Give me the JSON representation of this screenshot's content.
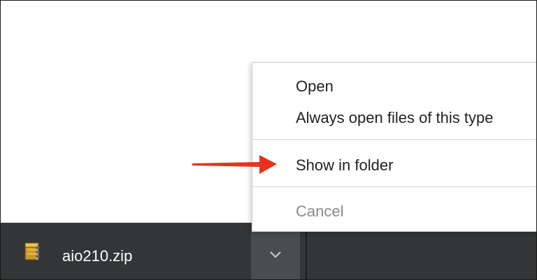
{
  "download": {
    "file_name": "aio210.zip",
    "icon": "archive-file-icon"
  },
  "context_menu": {
    "items": [
      {
        "label": "Open",
        "enabled": true
      },
      {
        "label": "Always open files of this type",
        "enabled": true
      },
      {
        "label": "Show in folder",
        "enabled": true
      },
      {
        "label": "Cancel",
        "enabled": false
      }
    ]
  },
  "colors": {
    "download_bar": "#333537",
    "chevron_button": "#4a4c4f",
    "arrow": "#e8321e",
    "menu_text": "#222222",
    "disabled_text": "#8a8a8a"
  }
}
